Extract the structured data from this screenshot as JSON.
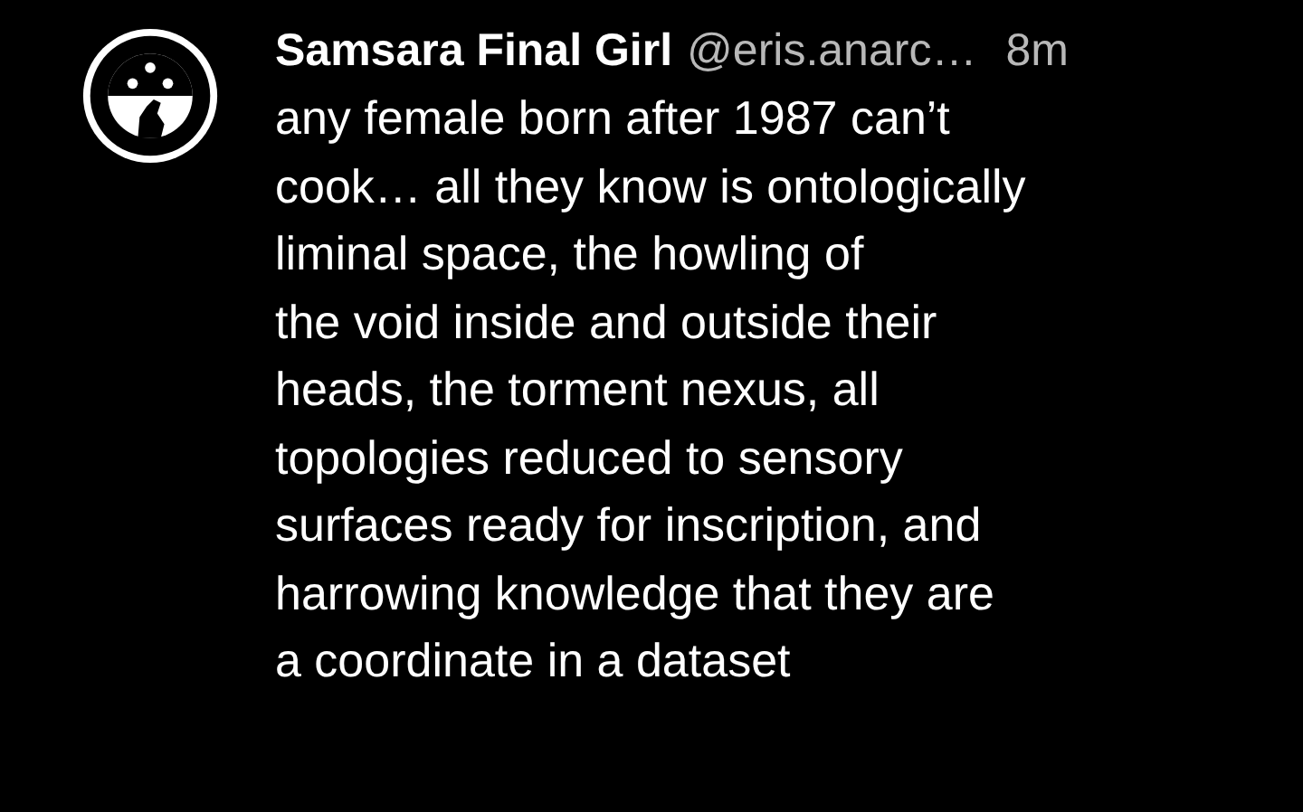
{
  "post": {
    "display_name": "Samsara Final Girl",
    "handle": "@eris.anarc…",
    "time": "8m",
    "text": "any female born after 1987 can’t\ncook… all they know is ontologically\nliminal space, the howling of\nthe void inside and outside their\nheads, the torment nexus, all\ntopologies reduced to sensory\nsurfaces ready for inscription, and\nharrowing knowledge that they are\na coordinate in a dataset"
  }
}
